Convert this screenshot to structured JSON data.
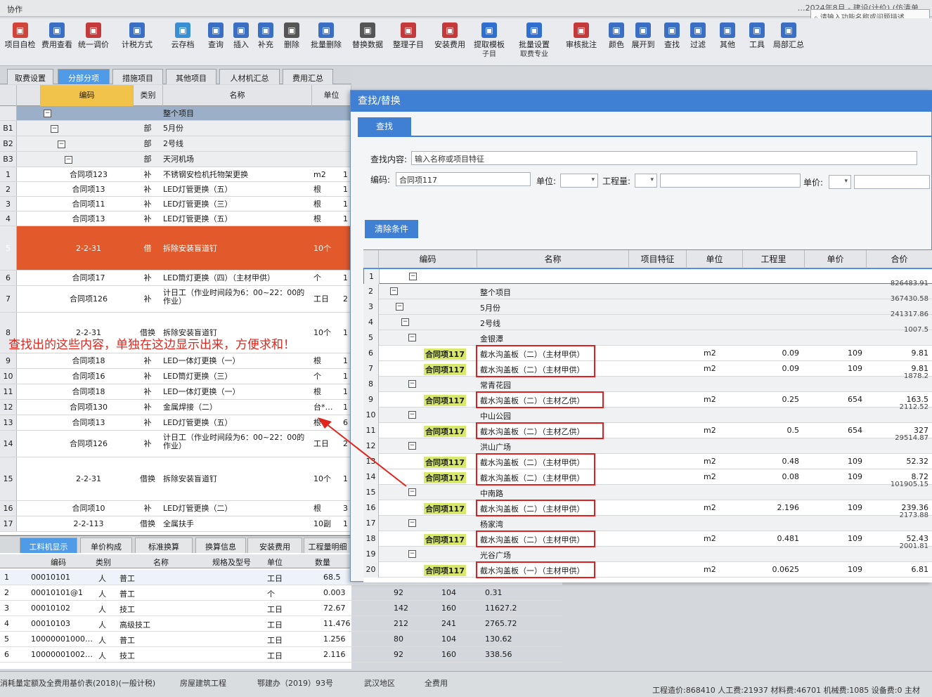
{
  "window": {
    "title": "协作",
    "title_right": "…2024年8月 - 建设(计价) (仿清单…"
  },
  "search": {
    "placeholder": "请输入功能名称或问题描述"
  },
  "toolbar": [
    {
      "label": "项目自检",
      "icon": "check-icon",
      "color": "#d0443a"
    },
    {
      "label": "费用查看",
      "icon": "fee-view-icon",
      "color": "#3a6fc4"
    },
    {
      "label": "统一调价",
      "icon": "adjust-price-icon",
      "color": "#c43a3a"
    },
    {
      "label": "计税方式",
      "icon": "tax-icon",
      "color": "#3a6fc4"
    },
    {
      "label": "云存档",
      "icon": "cloud-icon",
      "color": "#3a8fd4"
    },
    {
      "label": "查询",
      "icon": "query-icon",
      "color": "#3a6fc4"
    },
    {
      "label": "插入",
      "icon": "insert-icon",
      "color": "#3a6fc4"
    },
    {
      "label": "补充",
      "icon": "supplement-icon",
      "color": "#3a6fc4"
    },
    {
      "label": "删除",
      "icon": "delete-icon",
      "color": "#555555"
    },
    {
      "label": "批量删除",
      "icon": "batch-delete-icon",
      "color": "#3a6fc4"
    },
    {
      "label": "替换数据",
      "icon": "replace-icon",
      "color": "#555555"
    },
    {
      "label": "整理子目",
      "icon": "organize-icon",
      "color": "#c43a3a"
    },
    {
      "label": "安装费用",
      "icon": "install-fee-icon",
      "color": "#c43a3a"
    },
    {
      "label": "提取模板",
      "sub": "子目",
      "icon": "template-icon",
      "color": "#2f6fd0"
    },
    {
      "label": "批量设置",
      "sub": "取费专业",
      "icon": "fee-set-icon",
      "color": "#2f6fd0"
    },
    {
      "label": "审核批注",
      "icon": "review-icon",
      "color": "#c43a3a"
    },
    {
      "label": "颜色",
      "icon": "color-icon",
      "color": "#3a6fc4"
    },
    {
      "label": "展开到",
      "icon": "expand-icon",
      "color": "#3a6fc4"
    },
    {
      "label": "查找",
      "icon": "find-icon",
      "color": "#3a6fc4"
    },
    {
      "label": "过滤",
      "icon": "filter-icon",
      "color": "#3a6fc4"
    },
    {
      "label": "其他",
      "icon": "other-icon",
      "color": "#3a6fc4"
    },
    {
      "label": "工具",
      "icon": "tools-icon",
      "color": "#3a6fc4"
    },
    {
      "label": "局部汇总",
      "icon": "summary-icon",
      "color": "#3a6fc4"
    }
  ],
  "tabs": [
    "取费设置",
    "分部分项",
    "措施项目",
    "其他项目",
    "人材机汇总",
    "费用汇总"
  ],
  "left_grid": {
    "headers": [
      "编码",
      "类别",
      "名称",
      "单位"
    ],
    "rows": [
      {
        "n": "",
        "code": "",
        "kind": "",
        "name": "整个项目",
        "unit": "",
        "x": ""
      },
      {
        "n": "B1",
        "code": "",
        "kind": "部",
        "name": "5月份",
        "unit": "",
        "x": ""
      },
      {
        "n": "B2",
        "code": "",
        "kind": "部",
        "name": "2号线",
        "unit": "",
        "x": ""
      },
      {
        "n": "B3",
        "code": "",
        "kind": "部",
        "name": "天河机场",
        "unit": "",
        "x": ""
      },
      {
        "n": "1",
        "code": "合同项123",
        "kind": "补",
        "name": "不锈钢安检机托物架更换",
        "unit": "m2",
        "x": "1"
      },
      {
        "n": "2",
        "code": "合同项13",
        "kind": "补",
        "name": "LED灯管更换（五）",
        "unit": "根",
        "x": "1"
      },
      {
        "n": "3",
        "code": "合同项11",
        "kind": "补",
        "name": "LED灯管更换（三）",
        "unit": "根",
        "x": "1"
      },
      {
        "n": "4",
        "code": "合同项13",
        "kind": "补",
        "name": "LED灯管更换（五）",
        "unit": "根",
        "x": "1"
      },
      {
        "n": "5",
        "code": "2-2-31",
        "kind": "借",
        "name": "拆除安装盲道钉",
        "unit": "10个",
        "x": ""
      },
      {
        "n": "6",
        "code": "合同项17",
        "kind": "补",
        "name": "LED筒灯更换（四）（主材甲供）",
        "unit": "个",
        "x": "1"
      },
      {
        "n": "7",
        "code": "合同项126",
        "kind": "补",
        "name": "计日工（作业时间段为6：00~22：00的作业）",
        "unit": "工日",
        "x": "2"
      },
      {
        "n": "8",
        "code": "2-2-31",
        "kind": "借换",
        "name": "拆除安装盲道钉",
        "unit": "10个",
        "x": "1"
      },
      {
        "n": "9",
        "code": "合同项18",
        "kind": "补",
        "name": "LED一体灯更换（一）",
        "unit": "根",
        "x": "1"
      },
      {
        "n": "10",
        "code": "合同项16",
        "kind": "补",
        "name": "LED筒灯更换（三）",
        "unit": "个",
        "x": "1"
      },
      {
        "n": "11",
        "code": "合同项18",
        "kind": "补",
        "name": "LED一体灯更换（一）",
        "unit": "根",
        "x": "1"
      },
      {
        "n": "12",
        "code": "合同项130",
        "kind": "补",
        "name": "金属焊接（二）",
        "unit": "台*…",
        "x": "1"
      },
      {
        "n": "13",
        "code": "合同项13",
        "kind": "补",
        "name": "LED灯管更换（五）",
        "unit": "根",
        "x": "6"
      },
      {
        "n": "14",
        "code": "合同项126",
        "kind": "补",
        "name": "计日工（作业时间段为6：00~22：00的作业）",
        "unit": "工日",
        "x": "2"
      },
      {
        "n": "15",
        "code": "2-2-31",
        "kind": "借换",
        "name": "拆除安装盲道钉",
        "unit": "10个",
        "x": "1"
      },
      {
        "n": "16",
        "code": "合同项10",
        "kind": "补",
        "name": "LED灯管更换（二）",
        "unit": "根",
        "x": "3"
      },
      {
        "n": "17",
        "code": "2-2-113",
        "kind": "借换",
        "name": "全属扶手",
        "unit": "10副",
        "x": "1"
      }
    ]
  },
  "bottom_tabs": [
    "工料机显示",
    "单价构成",
    "标准换算",
    "换算信息",
    "安装费用",
    "工程量明细"
  ],
  "bottom_grid": {
    "headers": [
      "编码",
      "类别",
      "名称",
      "规格及型号",
      "单位",
      "数量"
    ],
    "rows": [
      {
        "n": "1",
        "code": "00010101",
        "kind": "人",
        "name": "普工",
        "unit": "工日",
        "qty": "68.5",
        "a": "",
        "b": "",
        "c": ""
      },
      {
        "n": "2",
        "code": "00010101@1",
        "kind": "人",
        "name": "普工",
        "unit": "个",
        "qty": "0.003",
        "a": "92",
        "b": "104",
        "c": "0.31"
      },
      {
        "n": "3",
        "code": "00010102",
        "kind": "人",
        "name": "技工",
        "unit": "工日",
        "qty": "72.67",
        "a": "142",
        "b": "160",
        "c": "11627.2"
      },
      {
        "n": "4",
        "code": "00010103",
        "kind": "人",
        "name": "高级技工",
        "unit": "工日",
        "qty": "11.476",
        "a": "212",
        "b": "241",
        "c": "2765.72"
      },
      {
        "n": "5",
        "code": "10000001000…",
        "kind": "人",
        "name": "普工",
        "unit": "工日",
        "qty": "1.256",
        "a": "80",
        "b": "104",
        "c": "130.62"
      },
      {
        "n": "6",
        "code": "10000001002…",
        "kind": "人",
        "name": "技工",
        "unit": "工日",
        "qty": "2.116",
        "a": "92",
        "b": "160",
        "c": "338.56"
      }
    ]
  },
  "status": {
    "standard": "消耗量定额及全费用基价表(2018)(一般计税)",
    "category": "房屋建筑工程",
    "doc": "鄂建办（2019）93号",
    "region": "武汉地区",
    "fee": "全费用",
    "summary": "工程造价:868410  人工费:21937  材料费:46701  机械费:1085  设备费:0  主材"
  },
  "dialog": {
    "title": "查找/替换",
    "tab": "查找",
    "content_label": "查找内容:",
    "content_placeholder": "输入名称或项目特征",
    "code_label": "编码:",
    "code_value": "合同项117",
    "unit_label": "单位:",
    "qty_label": "工程量:",
    "price_label": "单价:",
    "clear_button": "清除条件",
    "headers": [
      "编码",
      "名称",
      "项目特征",
      "单位",
      "工程里",
      "单价",
      "合价"
    ],
    "rows": [
      {
        "n": "1",
        "type": "root",
        "name": "",
        "total": ""
      },
      {
        "n": "2",
        "type": "group",
        "name": "整个项目",
        "total": "826483.91"
      },
      {
        "n": "3",
        "type": "group",
        "name": "5月份",
        "total": "367430.58"
      },
      {
        "n": "4",
        "type": "group",
        "name": "2号线",
        "total": "241317.86"
      },
      {
        "n": "5",
        "type": "group",
        "name": "金银潭",
        "total": "1007.5"
      },
      {
        "n": "6",
        "type": "item",
        "code": "合同项117",
        "name": "截水沟盖板（二）（主材甲供）",
        "unit": "m2",
        "qty": "0.09",
        "price": "109",
        "total": "9.81"
      },
      {
        "n": "7",
        "type": "item",
        "code": "合同项117",
        "name": "截水沟盖板（二）（主材甲供）",
        "unit": "m2",
        "qty": "0.09",
        "price": "109",
        "total": "9.81"
      },
      {
        "n": "8",
        "type": "group",
        "name": "常青花园",
        "total": "1878.2"
      },
      {
        "n": "9",
        "type": "item",
        "code": "合同项117",
        "name": "截水沟盖板（二）（主材乙供）",
        "unit": "m2",
        "qty": "0.25",
        "price": "654",
        "total": "163.5"
      },
      {
        "n": "10",
        "type": "group",
        "name": "中山公园",
        "total": "2112.52"
      },
      {
        "n": "11",
        "type": "item",
        "code": "合同项117",
        "name": "截水沟盖板（二）（主材乙供）",
        "unit": "m2",
        "qty": "0.5",
        "price": "654",
        "total": "327"
      },
      {
        "n": "12",
        "type": "group",
        "name": "洪山广场",
        "total": "29514.87"
      },
      {
        "n": "13",
        "type": "item",
        "code": "合同项117",
        "name": "截水沟盖板（二）（主材甲供）",
        "unit": "m2",
        "qty": "0.48",
        "price": "109",
        "total": "52.32"
      },
      {
        "n": "14",
        "type": "item",
        "code": "合同项117",
        "name": "截水沟盖板（二）（主材甲供）",
        "unit": "m2",
        "qty": "0.08",
        "price": "109",
        "total": "8.72"
      },
      {
        "n": "15",
        "type": "group",
        "name": "中南路",
        "total": "101905.15"
      },
      {
        "n": "16",
        "type": "item",
        "code": "合同项117",
        "name": "截水沟盖板（二）（主材甲供）",
        "unit": "m2",
        "qty": "2.196",
        "price": "109",
        "total": "239.36"
      },
      {
        "n": "17",
        "type": "group",
        "name": "杨家湾",
        "total": "2173.88"
      },
      {
        "n": "18",
        "type": "item",
        "code": "合同项117",
        "name": "截水沟盖板（二）（主材甲供）",
        "unit": "m2",
        "qty": "0.481",
        "price": "109",
        "total": "52.43"
      },
      {
        "n": "19",
        "type": "group",
        "name": "光谷广场",
        "total": "2001.81"
      },
      {
        "n": "20",
        "type": "item",
        "code": "合同项117",
        "name": "截水沟盖板（一）（主材甲供）",
        "unit": "m2",
        "qty": "0.0625",
        "price": "109",
        "total": "6.81"
      }
    ]
  },
  "annotation": "查找出的这些内容，单独在这边显示出来，方便求和！",
  "colors": {
    "accent": "#3f7fd4",
    "highlight": "#e25a2c",
    "annotation": "#e0261c",
    "code_bg": "#d8e86a"
  }
}
